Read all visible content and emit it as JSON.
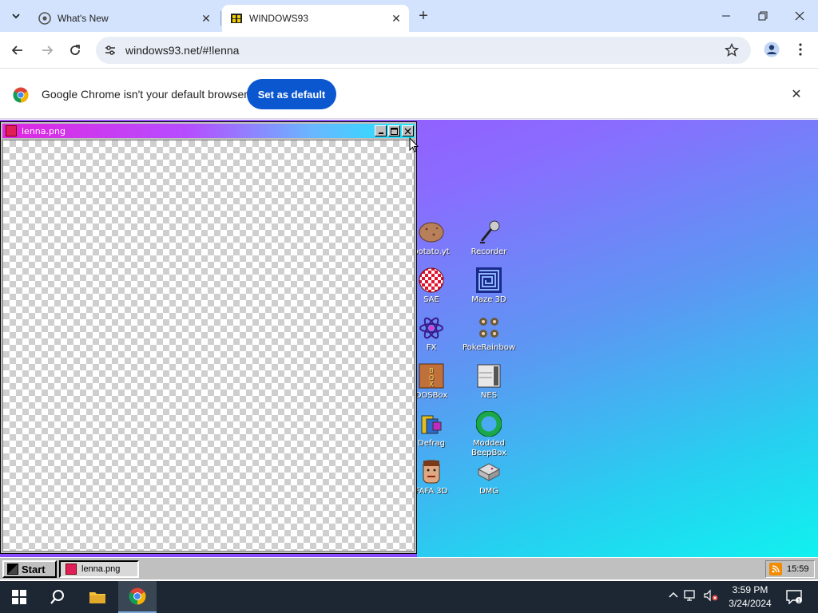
{
  "browser": {
    "tabs": [
      {
        "label": "What's New",
        "active": false
      },
      {
        "label": "WINDOWS93",
        "active": true
      }
    ],
    "url": "windows93.net/#!lenna",
    "infobar": {
      "message": "Google Chrome isn't your default browser",
      "button_label": "Set as default"
    }
  },
  "w93": {
    "window": {
      "title": "lenna.png"
    },
    "desktop_icons": [
      {
        "label": "potato.yt",
        "icon": "potato-icon"
      },
      {
        "label": "Recorder",
        "icon": "microphone-icon"
      },
      {
        "label": "SAE",
        "icon": "checkered-ball-icon"
      },
      {
        "label": "Maze 3D",
        "icon": "maze-icon"
      },
      {
        "label": "FX",
        "icon": "atom-icon"
      },
      {
        "label": "PokeRainbow",
        "icon": "pokerainbow-icon"
      },
      {
        "label": "DOSBox",
        "icon": "dosbox-icon"
      },
      {
        "label": "NES",
        "icon": "nes-console-icon"
      },
      {
        "label": "Defrag",
        "icon": "defrag-icon"
      },
      {
        "label": "Modded BeepBox",
        "icon": "beepbox-ring-icon"
      },
      {
        "label": "FAFA 3D",
        "icon": "face-icon"
      },
      {
        "label": "DMG",
        "icon": "dmg-console-icon"
      }
    ],
    "taskbar": {
      "start_label": "Start",
      "task_label": "lenna.png",
      "tray_time": "15:59"
    }
  },
  "windows": {
    "clock_time": "3:59 PM",
    "clock_date": "3/24/2024"
  },
  "colors": {
    "chrome_blue": "#0b57d0",
    "tabstrip": "#d3e3fd",
    "win_taskbar": "#1c2733"
  }
}
